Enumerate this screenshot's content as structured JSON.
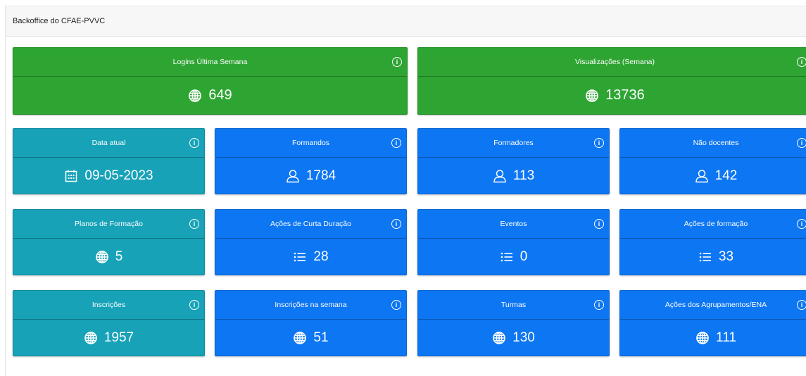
{
  "header": {
    "title": "Backoffice do CFAE-PVVC"
  },
  "cards": {
    "logins": {
      "title": "Logins Última Semana",
      "value": "649",
      "icon": "globe-icon",
      "color": "#2ea533"
    },
    "views": {
      "title": "Visualizações (Semana)",
      "value": "13736",
      "icon": "globe-icon",
      "color": "#2ea533"
    },
    "date": {
      "title": "Data atual",
      "value": "09-05-2023",
      "icon": "calendar-icon",
      "color": "#17a2b8"
    },
    "formandos": {
      "title": "Formandos",
      "value": "1784",
      "icon": "person-icon",
      "color": "#0d76f2"
    },
    "formadores": {
      "title": "Formadores",
      "value": "113",
      "icon": "person-icon",
      "color": "#0d76f2"
    },
    "nao_docentes": {
      "title": "Não docentes",
      "value": "142",
      "icon": "person-icon",
      "color": "#0d76f2"
    },
    "planos": {
      "title": "Planos de Formação",
      "value": "5",
      "icon": "globe-icon",
      "color": "#17a2b8"
    },
    "acoes_curta": {
      "title": "Ações de Curta Duração",
      "value": "28",
      "icon": "list-icon",
      "color": "#0d76f2"
    },
    "eventos": {
      "title": "Eventos",
      "value": "0",
      "icon": "list-icon",
      "color": "#0d76f2"
    },
    "acoes_formacao": {
      "title": "Ações de formação",
      "value": "33",
      "icon": "list-icon",
      "color": "#0d76f2"
    },
    "inscricoes": {
      "title": "Inscrições",
      "value": "1957",
      "icon": "globe-icon",
      "color": "#17a2b8"
    },
    "inscricoes_semana": {
      "title": "Inscrições na semana",
      "value": "51",
      "icon": "globe-icon",
      "color": "#0d76f2"
    },
    "turmas": {
      "title": "Turmas",
      "value": "130",
      "icon": "globe-icon",
      "color": "#0d76f2"
    },
    "agrupamentos": {
      "title": "Ações dos Agrupamentos/ENA",
      "value": "111",
      "icon": "globe-icon",
      "color": "#0d76f2"
    }
  },
  "info_glyph": "i"
}
